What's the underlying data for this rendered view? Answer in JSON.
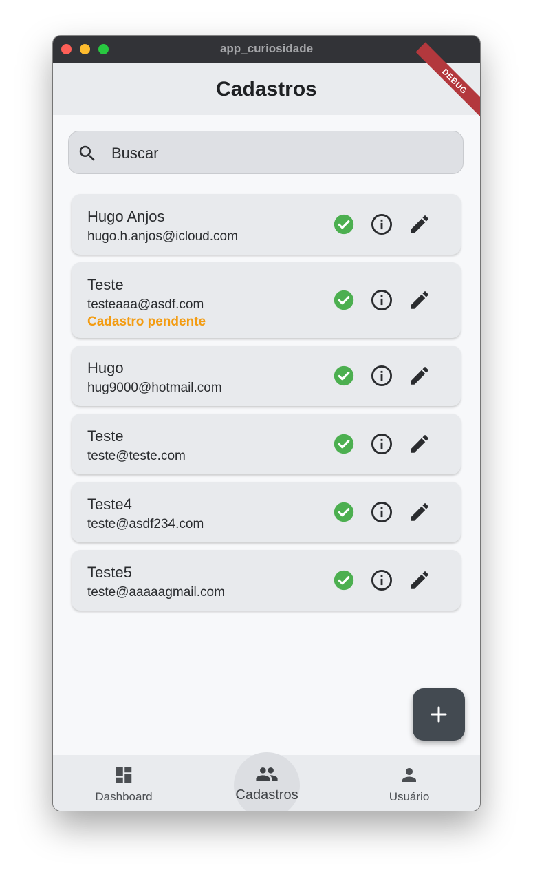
{
  "window": {
    "title": "app_curiosidade"
  },
  "appbar": {
    "title": "Cadastros",
    "debug_banner": "DEBUG"
  },
  "search": {
    "placeholder": "Buscar",
    "value": ""
  },
  "records": [
    {
      "name": "Hugo Anjos",
      "email": "hugo.h.anjos@icloud.com",
      "status": ""
    },
    {
      "name": "Teste",
      "email": "testeaaa@asdf.com",
      "status": "Cadastro pendente"
    },
    {
      "name": "Hugo",
      "email": "hug9000@hotmail.com",
      "status": ""
    },
    {
      "name": "Teste",
      "email": "teste@teste.com",
      "status": ""
    },
    {
      "name": "Teste4",
      "email": "teste@asdf234.com",
      "status": ""
    },
    {
      "name": "Teste5",
      "email": "teste@aaaaagmail.com",
      "status": ""
    }
  ],
  "actions": [
    "check-circle-icon",
    "info-icon",
    "edit-pencil-icon"
  ],
  "fab": {
    "icon": "plus-icon"
  },
  "bottom_nav": {
    "selected": "Cadastros",
    "items": [
      {
        "label": "Dashboard",
        "icon": "dashboard-icon"
      },
      {
        "label": "Cadastros",
        "icon": "people-icon"
      },
      {
        "label": "Usuário",
        "icon": "person-icon"
      }
    ]
  },
  "colors": {
    "check_green": "#4caf50",
    "pending_orange": "#f39c12",
    "fab_bg": "#434a51",
    "debug_red": "#b3383d"
  }
}
